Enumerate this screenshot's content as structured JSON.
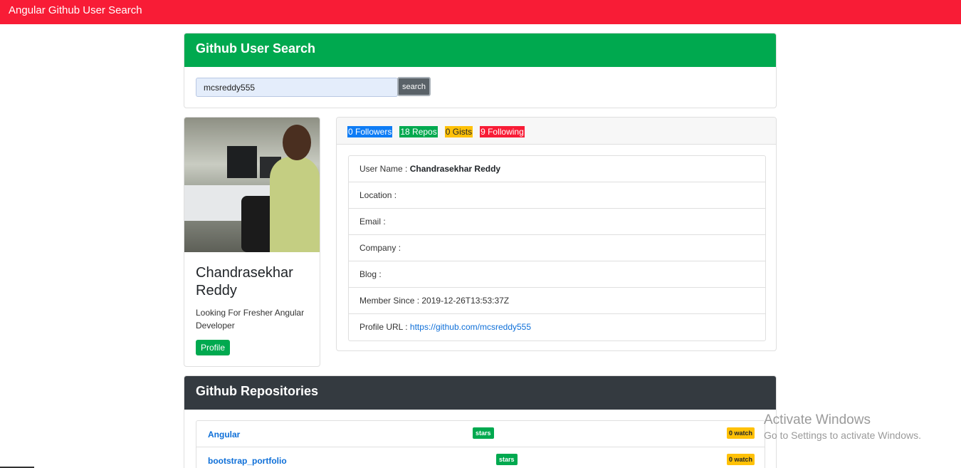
{
  "navbar": {
    "brand": "Angular Github User Search"
  },
  "search": {
    "title": "Github User Search",
    "value": "mcsreddy555",
    "button_label": "search"
  },
  "profile": {
    "name": "Chandrasekhar Reddy",
    "bio": "Looking For Fresher Angular Developer",
    "button_label": "Profile"
  },
  "stats": {
    "followers": "0 Followers",
    "repos": "18 Repos",
    "gists": "0 Gists",
    "following": "9 Following"
  },
  "details": {
    "username_label": "User Name :",
    "username_value": "Chandrasekhar Reddy",
    "location_label": "Location :",
    "email_label": "Email :",
    "company_label": "Company :",
    "blog_label": "Blog :",
    "member_since_label": "Member Since :",
    "member_since_value": "2019-12-26T13:53:37Z",
    "profile_url_label": "Profile URL :",
    "profile_url_value": "https://github.com/mcsreddy555"
  },
  "repositories": {
    "title": "Github Repositories",
    "items": [
      {
        "name": "Angular",
        "stars_label": "stars",
        "watch_label": "0 watch"
      },
      {
        "name": "bootstrap_portfolio",
        "stars_label": "stars",
        "watch_label": "0 watch"
      }
    ]
  },
  "watermark": {
    "line1": "Activate Windows",
    "line2": "Go to Settings to activate Windows."
  },
  "colors": {
    "navbar": "#f81c36",
    "success": "#00a94f",
    "primary": "#0e7cf5",
    "warning": "#ffc107",
    "dark": "#343a40"
  }
}
